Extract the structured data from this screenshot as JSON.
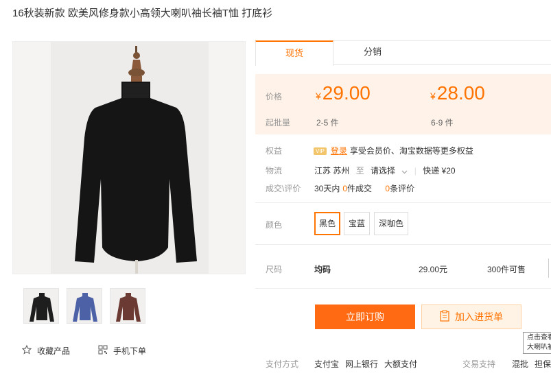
{
  "product": {
    "title": "16秋装新款 欧美风修身款小高领大喇叭袖长袖T恤 打底衫"
  },
  "gallery": {
    "thumbnails": [
      {
        "color_name": "black",
        "hex": "#1e1e1e"
      },
      {
        "color_name": "royal-blue",
        "hex": "#4d62a6"
      },
      {
        "color_name": "brown",
        "hex": "#6b3a32"
      }
    ]
  },
  "actions": {
    "favorite_label": "收藏产品",
    "mobile_order_label": "手机下单"
  },
  "tabs": [
    {
      "label": "现货",
      "active": true
    },
    {
      "label": "分销",
      "active": false
    }
  ],
  "price": {
    "price_label": "价格",
    "moq_label": "起批量",
    "currency": "¥",
    "tiers": [
      {
        "price": "29.00",
        "range": "2-5 件"
      },
      {
        "price": "28.00",
        "range": "6-9 件"
      }
    ]
  },
  "rights": {
    "label": "权益",
    "vip_badge": "VIP",
    "login_link": "登录",
    "text": "享受会员价、淘宝数据等更多权益"
  },
  "logistics": {
    "label": "物流",
    "origin": "江苏 苏州",
    "to": "至",
    "destination": "请选择",
    "express": "快递 ¥20"
  },
  "deals": {
    "label": "成交\\评价",
    "days_prefix": "30天内",
    "deal_count": "0",
    "deal_suffix": "件成交",
    "review_count": "0",
    "review_suffix": "条评价"
  },
  "colors": {
    "label": "颜色",
    "options": [
      {
        "label": "黑色",
        "selected": true
      },
      {
        "label": "宝蓝",
        "selected": false
      },
      {
        "label": "深咖色",
        "selected": false
      }
    ]
  },
  "size": {
    "label": "尺码",
    "value": "均码",
    "price": "29.00元",
    "stock": "300件可售"
  },
  "buttons": {
    "buy_now": "立即订购",
    "add_cart": "加入进货单"
  },
  "tooltip": {
    "line1": "点击查看",
    "line2": "大喇叭袖"
  },
  "footer": {
    "payment_label": "支付方式",
    "payment_methods": [
      "支付宝",
      "网上银行",
      "大额支付"
    ],
    "trade_label": "交易支持",
    "trade_items": [
      "混批",
      "担保"
    ]
  },
  "colors_ui": {
    "accent": "#ff7300",
    "price_bg": "#fff2e8"
  }
}
